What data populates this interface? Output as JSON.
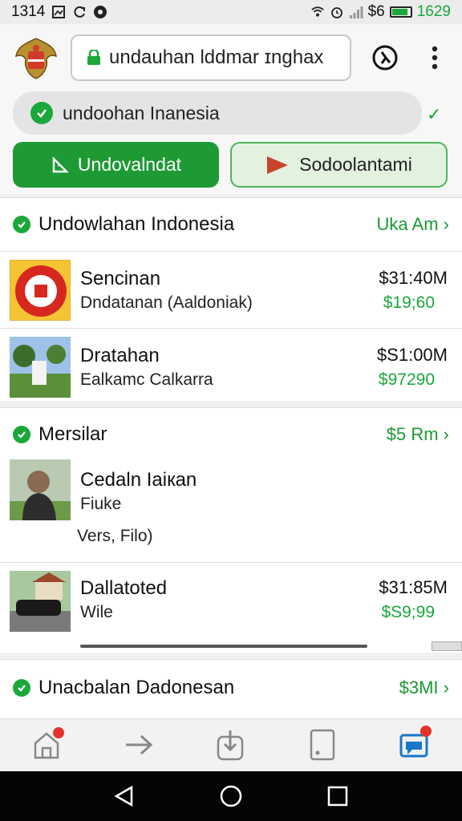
{
  "status_bar": {
    "time": "1314",
    "carrier": "$6",
    "battery_pct": "1629",
    "battery_level": 0.9
  },
  "header": {
    "url": "undauhan lddmar ɪnghax",
    "search_text": "undoohan Inanesia",
    "primary_button": "Undovalndat",
    "secondary_button": "Sodoolantami"
  },
  "sections": [
    {
      "title": "Undowlahan Indonesia",
      "link": "Uka Am",
      "rows": [
        {
          "title": "Sencinan",
          "subtitle": "Dndatanan (Aaldoniak)",
          "price": "$31:40M",
          "price2": "$19;60"
        },
        {
          "title": "Dratahan",
          "subtitle": "Ealkamc Calkarra",
          "price": "$S1:00M",
          "price2": "$97290"
        }
      ]
    },
    {
      "title": "Mersilar",
      "link": "$5 Rm",
      "rows": [
        {
          "title": "Cedaln Iaiкan",
          "subtitle": "Fiuke",
          "extra": "Vers, Filo)"
        },
        {
          "title": "Dallatoted",
          "subtitle": "Wile",
          "price": "$31:85M",
          "price2": "$S9;99"
        }
      ]
    },
    {
      "title": "Unacbalan Dadonesan",
      "link": "$3MI"
    }
  ],
  "colors": {
    "accent": "#1e9a34",
    "accent_light": "#e3f1df",
    "badge": "#e2322a"
  },
  "icons": [
    "emblem-icon",
    "lock-icon",
    "history-icon",
    "more-vert-icon",
    "check-icon",
    "download-icon",
    "play-icon",
    "home-icon",
    "forward-icon",
    "download-nav-icon",
    "tablet-icon",
    "chat-icon",
    "back-nav-icon",
    "home-nav-icon",
    "recents-nav-icon"
  ]
}
